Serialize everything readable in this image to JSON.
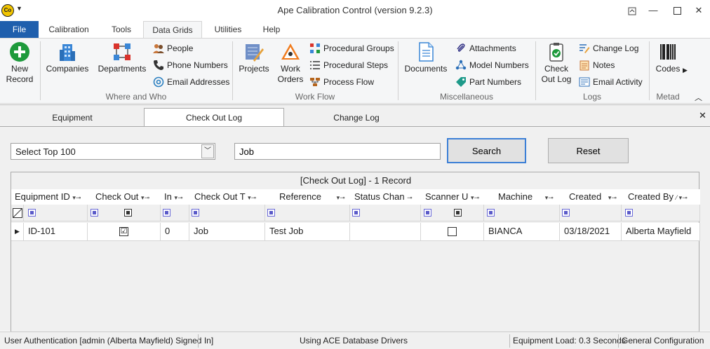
{
  "window": {
    "logo_text": "Co",
    "title": "Ape Calibration Control (version 9.2.3)"
  },
  "menu_tabs": [
    "File",
    "Calibration",
    "Tools",
    "Data Grids",
    "Utilities",
    "Help"
  ],
  "ribbon": {
    "new_record": [
      "New",
      "Record"
    ],
    "companies": "Companies",
    "departments": "Departments",
    "people": "People",
    "phone_numbers": "Phone Numbers",
    "email_addresses": "Email Addresses",
    "group_where_who": "Where and Who",
    "projects": "Projects",
    "work_orders": [
      "Work",
      "Orders"
    ],
    "procedural_groups": "Procedural Groups",
    "procedural_steps": "Procedural Steps",
    "process_flow": "Process Flow",
    "group_work_flow": "Work Flow",
    "documents": "Documents",
    "attachments": "Attachments",
    "model_numbers": "Model Numbers",
    "part_numbers": "Part Numbers",
    "group_misc": "Miscellaneous",
    "check_out_log": [
      "Check",
      "Out Log"
    ],
    "change_log": "Change Log",
    "notes": "Notes",
    "email_activity": "Email Activity",
    "group_logs": "Logs",
    "codes": "Codes",
    "group_meta": "Metad"
  },
  "doc_tabs": [
    "Equipment",
    "Check Out Log",
    "Change Log"
  ],
  "controls": {
    "select_value": "Select Top 100",
    "search_value": "Job",
    "search_label": "Search",
    "reset_label": "Reset"
  },
  "grid": {
    "caption": "[Check Out Log] - 1 Record",
    "columns": [
      "Equipment ID",
      "Check Out",
      "In",
      "Check Out T",
      "Reference",
      "Status Chan",
      "Scanner U",
      "Machine",
      "Created",
      "Created By"
    ],
    "row": {
      "equipment_id": "ID-101",
      "check_out_mark": "☑",
      "in": "0",
      "check_out_type": "Job",
      "reference": "Test Job",
      "status_change": "",
      "scanner_used_mark": "",
      "machine": "BIANCA",
      "created": "03/18/2021",
      "created_by": "Alberta Mayfield"
    }
  },
  "status": {
    "auth": "User Authentication [admin (Alberta Mayfield) Signed In]",
    "drivers": "Using ACE Database Drivers",
    "load": "Equipment Load: 0.3 Seconds",
    "config": "General Configuration"
  }
}
